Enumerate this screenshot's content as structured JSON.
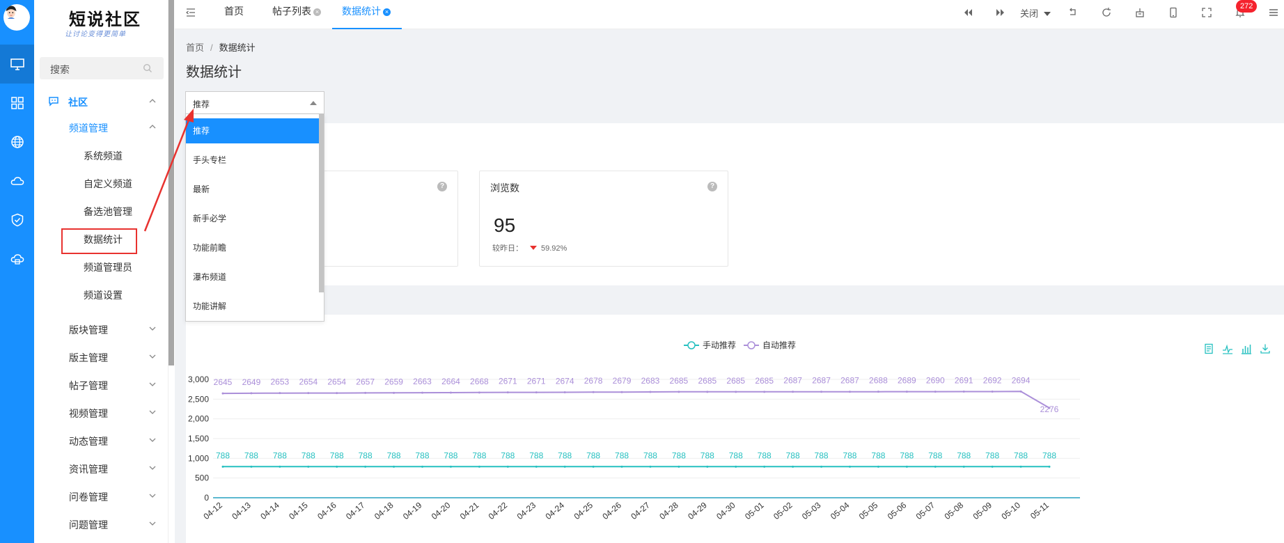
{
  "brand": {
    "title": "短说社区",
    "subtitle": "让讨论变得更简单"
  },
  "search": {
    "placeholder": "搜索"
  },
  "rail": {
    "items": [
      "desktop-icon",
      "grid-icon",
      "globe-icon",
      "cloud-icon",
      "shield-icon",
      "cloud-service-icon"
    ]
  },
  "sidebar": {
    "group": "社区",
    "submenu": "频道管理",
    "children": [
      "系统频道",
      "自定义频道",
      "备选池管理",
      "数据统计",
      "频道管理员",
      "频道设置"
    ],
    "sections": [
      "版块管理",
      "版主管理",
      "帖子管理",
      "视频管理",
      "动态管理",
      "资讯管理",
      "问卷管理",
      "问题管理"
    ]
  },
  "tabs": [
    {
      "label": "首页"
    },
    {
      "label": "帖子列表",
      "close": "×"
    },
    {
      "label": "数据统计",
      "close": "×"
    }
  ],
  "toolbar": {
    "close_label": "关闭",
    "badge": "272"
  },
  "breadcrumb": {
    "home": "首页",
    "sep": "/",
    "current": "数据统计"
  },
  "page": {
    "title": "数据统计"
  },
  "select": {
    "value": "推荐",
    "options": [
      "推荐",
      "手头专栏",
      "最新",
      "新手必学",
      "功能前瞻",
      "瀑布频道",
      "功能讲解"
    ]
  },
  "cards": [
    {
      "title": "浏览数",
      "help": "?",
      "value": "95",
      "compare_label": "较昨日：",
      "compare_value": "59.92%"
    }
  ],
  "colors": {
    "primary": "#1890ff",
    "manual": "#26c0c0",
    "auto": "#ab8fd9",
    "down": "#e8322f"
  },
  "chart_data": {
    "type": "line",
    "categories": [
      "04-12",
      "04-13",
      "04-14",
      "04-15",
      "04-16",
      "04-17",
      "04-18",
      "04-19",
      "04-20",
      "04-21",
      "04-22",
      "04-23",
      "04-24",
      "04-25",
      "04-26",
      "04-27",
      "04-28",
      "04-29",
      "04-30",
      "05-01",
      "05-02",
      "05-03",
      "05-04",
      "05-05",
      "05-06",
      "05-07",
      "05-08",
      "05-09",
      "05-10",
      "05-11"
    ],
    "series": [
      {
        "name": "手动推荐",
        "values": [
          788,
          788,
          788,
          788,
          788,
          788,
          788,
          788,
          788,
          788,
          788,
          788,
          788,
          788,
          788,
          788,
          788,
          788,
          788,
          788,
          788,
          788,
          788,
          788,
          788,
          788,
          788,
          788,
          788,
          788
        ]
      },
      {
        "name": "自动推荐",
        "values": [
          2645,
          2649,
          2653,
          2654,
          2654,
          2657,
          2659,
          2663,
          2664,
          2668,
          2671,
          2671,
          2674,
          2678,
          2679,
          2683,
          2685,
          2685,
          2685,
          2685,
          2687,
          2687,
          2687,
          2688,
          2689,
          2690,
          2691,
          2692,
          2694,
          2276
        ]
      }
    ],
    "yticks": [
      "0",
      "500",
      "1,000",
      "1,500",
      "2,000",
      "2,500",
      "3,000"
    ],
    "ylim": [
      0,
      3000
    ],
    "legend_position": "top-center",
    "grid": true
  }
}
